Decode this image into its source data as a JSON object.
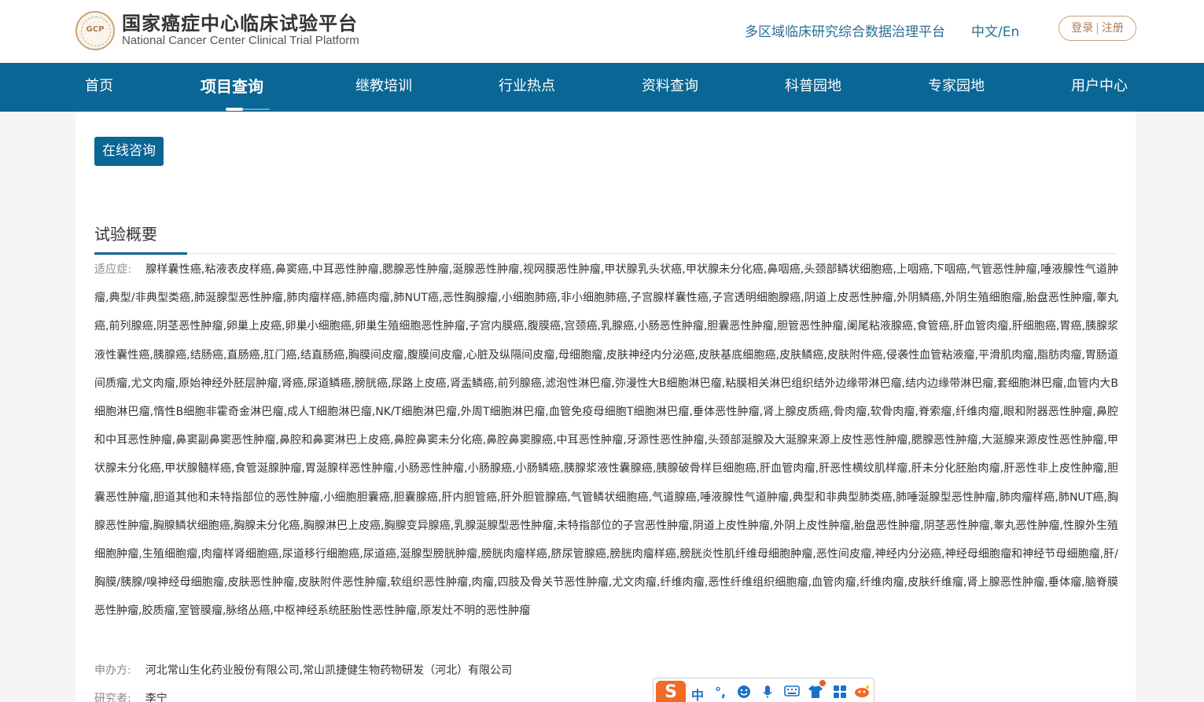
{
  "header": {
    "logo_text": "GCP",
    "title": "国家癌症中心临床试验平台",
    "subtitle": "National Cancer Center Clinical Trial Platform",
    "platform_link": "多区域临床研究综合数据治理平台",
    "lang_toggle": "中文/En",
    "login": "登录",
    "separator": "|",
    "register": "注册"
  },
  "nav": {
    "items": [
      "首页",
      "项目查询",
      "继教培训",
      "行业热点",
      "资料查询",
      "科普园地",
      "专家园地",
      "用户中心"
    ],
    "active": "项目查询"
  },
  "main": {
    "consult_button": "在线咨询",
    "section_title": "试验概要",
    "indications_label": "适应症:",
    "indications_value": "腺样囊性癌,粘液表皮样癌,鼻窦癌,中耳恶性肿瘤,腮腺恶性肿瘤,涎腺恶性肿瘤,视网膜恶性肿瘤,甲状腺乳头状癌,甲状腺未分化癌,鼻咽癌,头颈部鳞状细胞癌,上咽癌,下咽癌,气管恶性肿瘤,唾液腺性气道肿瘤,典型/非典型类癌,肺涎腺型恶性肿瘤,肺肉瘤样癌,肺癌肉瘤,肺NUT癌,恶性胸腺瘤,小细胞肺癌,非小细胞肺癌,子宫腺样囊性癌,子宫透明细胞腺癌,阴道上皮恶性肿瘤,外阴鳞癌,外阴生殖细胞瘤,胎盘恶性肿瘤,睾丸癌,前列腺癌,阴茎恶性肿瘤,卵巢上皮癌,卵巢小细胞癌,卵巢生殖细胞恶性肿瘤,子宫内膜癌,腹膜癌,宫颈癌,乳腺癌,小肠恶性肿瘤,胆囊恶性肿瘤,胆管恶性肿瘤,阑尾粘液腺癌,食管癌,肝血管肉瘤,肝细胞癌,胃癌,胰腺浆液性囊性癌,胰腺癌,结肠癌,直肠癌,肛门癌,结直肠癌,胸膜间皮瘤,腹膜间皮瘤,心脏及纵隔间皮瘤,母细胞瘤,皮肤神经内分泌癌,皮肤基底细胞癌,皮肤鳞癌,皮肤附件癌,侵袭性血管粘液瘤,平滑肌肉瘤,脂肪肉瘤,胃肠道间质瘤,尤文肉瘤,原始神经外胚层肿瘤,肾癌,尿道鳞癌,膀胱癌,尿路上皮癌,肾盂鳞癌,前列腺癌,滤泡性淋巴瘤,弥漫性大B细胞淋巴瘤,粘膜相关淋巴组织结外边缘带淋巴瘤,结内边缘带淋巴瘤,套细胞淋巴瘤,血管内大B细胞淋巴瘤,惰性B细胞非霍奇金淋巴瘤,成人T细胞淋巴瘤,NK/T细胞淋巴瘤,外周T细胞淋巴瘤,血管免疫母细胞T细胞淋巴瘤,垂体恶性肿瘤,肾上腺皮质癌,骨肉瘤,软骨肉瘤,脊索瘤,纤维肉瘤,眼和附器恶性肿瘤,鼻腔和中耳恶性肿瘤,鼻窦副鼻窦恶性肿瘤,鼻腔和鼻窦淋巴上皮癌,鼻腔鼻窦未分化癌,鼻腔鼻窦腺癌,中耳恶性肿瘤,牙源性恶性肿瘤,头颈部涎腺及大涎腺来源上皮性恶性肿瘤,腮腺恶性肿瘤,大涎腺来源皮性恶性肿瘤,甲状腺未分化癌,甲状腺髓样癌,食管涎腺肿瘤,胃涎腺样恶性肿瘤,小肠恶性肿瘤,小肠腺癌,小肠鳞癌,胰腺浆液性囊腺癌,胰腺破骨样巨细胞癌,肝血管肉瘤,肝恶性横纹肌样瘤,肝未分化胚胎肉瘤,肝恶性非上皮性肿瘤,胆囊恶性肿瘤,胆道其他和未特指部位的恶性肿瘤,小细胞胆囊癌,胆囊腺癌,肝内胆管癌,肝外胆管腺癌,气管鳞状细胞癌,气道腺癌,唾液腺性气道肿瘤,典型和非典型肺类癌,肺唾涎腺型恶性肿瘤,肺肉瘤样癌,肺NUT癌,胸腺恶性肿瘤,胸腺鳞状细胞癌,胸腺未分化癌,胸腺淋巴上皮癌,胸腺变异腺癌,乳腺涎腺型恶性肿瘤,未特指部位的子宫恶性肿瘤,阴道上皮性肿瘤,外阴上皮性肿瘤,胎盘恶性肿瘤,阴茎恶性肿瘤,睾丸恶性肿瘤,性腺外生殖细胞肿瘤,生殖细胞瘤,肉瘤样肾细胞癌,尿道移行细胞癌,尿道癌,涎腺型膀胱肿瘤,膀胱肉瘤样癌,脐尿管腺癌,膀胱肉瘤样癌,膀胱炎性肌纤维母细胞肿瘤,恶性间皮瘤,神经内分泌癌,神经母细胞瘤和神经节母细胞瘤,肝/胸膜/胰腺/嗅神经母细胞瘤,皮肤恶性肿瘤,皮肤附件恶性肿瘤,软组织恶性肿瘤,肉瘤,四肢及骨关节恶性肿瘤,尤文肉瘤,纤维肉瘤,恶性纤维组织细胞瘤,血管肉瘤,纤维肉瘤,皮肤纤维瘤,肾上腺恶性肿瘤,垂体瘤,脑脊膜恶性肿瘤,胶质瘤,室管膜瘤,脉络丛癌,中枢神经系统胚胎性恶性肿瘤,原发灶不明的恶性肿瘤",
    "sponsor_label": "申办方:",
    "sponsor_value": "河北常山生化药业股份有限公司,常山凯捷健生物药物研发（河北）有限公司",
    "investigator_label": "研究者:",
    "investigator_value": "李宁"
  },
  "ime_toolbar": {
    "logo": "S",
    "mode": "中",
    "punct": "°,",
    "icons": [
      "emoji-icon",
      "mic-icon",
      "keyboard-icon",
      "skin-icon",
      "apps-icon",
      "tools-icon"
    ]
  },
  "colors": {
    "nav_bg": "#0a6694",
    "accent_gold": "#c9a27c",
    "link_blue": "#2a6f93"
  }
}
